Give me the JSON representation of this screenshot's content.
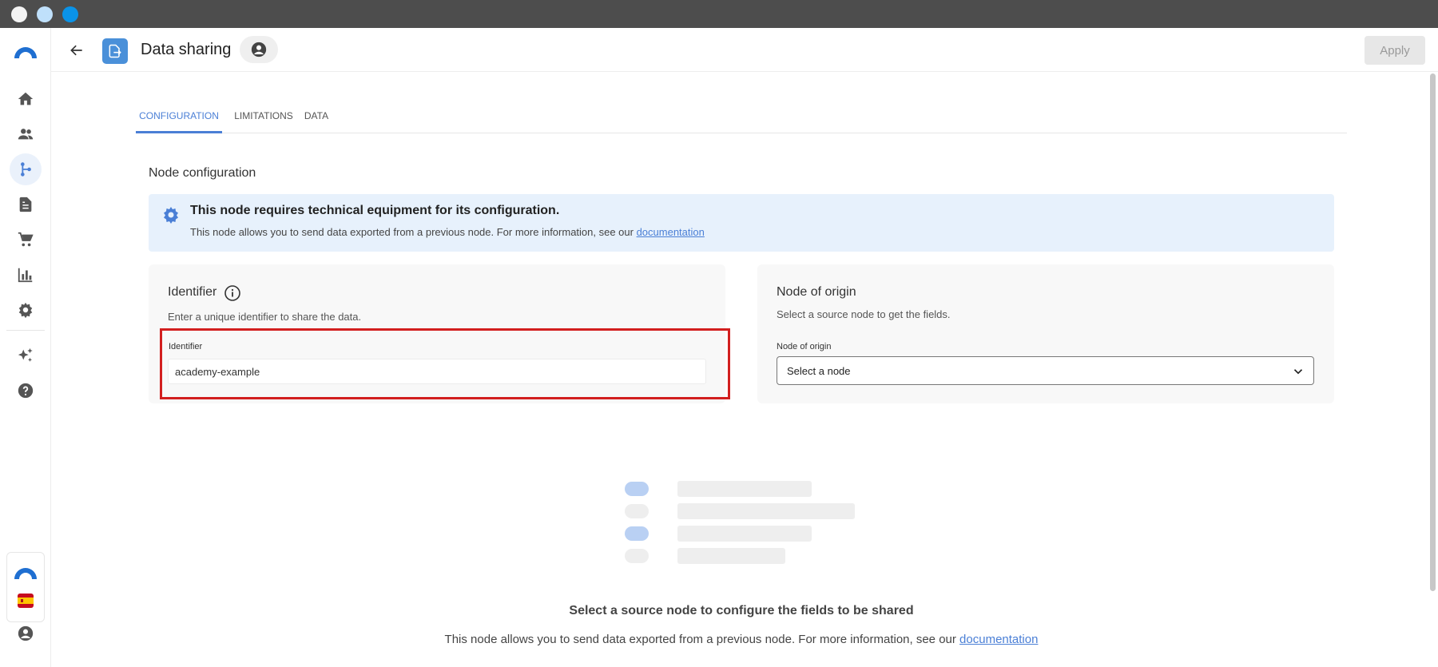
{
  "window": {
    "dots": [
      "close",
      "minimize",
      "maximize"
    ]
  },
  "sidebar": {
    "logo": "brand-logo",
    "items": [
      {
        "name": "home-icon",
        "active": false
      },
      {
        "name": "users-icon",
        "active": false
      },
      {
        "name": "flows-icon",
        "active": true
      },
      {
        "name": "documents-icon",
        "active": false
      },
      {
        "name": "cart-icon",
        "active": false
      },
      {
        "name": "analytics-icon",
        "active": false
      },
      {
        "name": "settings-icon",
        "active": false
      },
      {
        "name": "sparkles-icon",
        "active": false
      },
      {
        "name": "help-icon",
        "active": false
      }
    ],
    "bottom": [
      "brand-logo",
      "spain-flag-icon",
      "account-icon"
    ]
  },
  "header": {
    "title": "Data sharing",
    "apply_label": "Apply"
  },
  "tabs": [
    {
      "label": "CONFIGURATION",
      "active": true
    },
    {
      "label": "LIMITATIONS",
      "active": false
    },
    {
      "label": "DATA",
      "active": false
    }
  ],
  "main": {
    "section_title": "Node configuration",
    "banner": {
      "title": "This node requires technical equipment for its configuration.",
      "text": "This node allows you to send data exported from a previous node. For more information, see our ",
      "link": "documentation"
    },
    "identifier_card": {
      "title": "Identifier",
      "subtitle": "Enter a unique identifier to share the data.",
      "field_label": "Identifier",
      "field_value": "academy-example"
    },
    "origin_card": {
      "title": "Node of origin",
      "subtitle": "Select a source node to get the fields.",
      "field_label": "Node of origin",
      "select_value": "Select a node"
    },
    "empty_state": {
      "title": "Select a source node to configure the fields to be shared",
      "text": "This node allows you to send data exported from a previous node. For more information, see our ",
      "link": "documentation"
    }
  },
  "colors": {
    "accent": "#4a7fd6",
    "banner_bg": "#e7f1fc",
    "highlight": "#d21f1f",
    "skeleton_blue": "#b9d0f3",
    "skeleton_grey": "#eeeeee"
  }
}
